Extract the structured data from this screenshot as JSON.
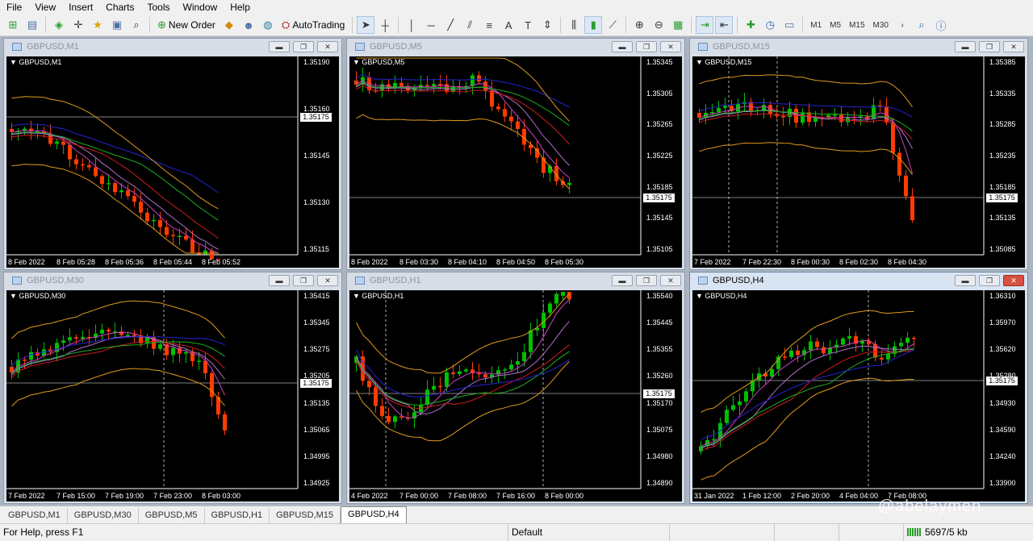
{
  "menu": [
    "File",
    "View",
    "Insert",
    "Charts",
    "Tools",
    "Window",
    "Help"
  ],
  "toolbar": {
    "new_order": "New Order",
    "autotrading": "AutoTrading",
    "timeframes": [
      "M1",
      "M5",
      "M15",
      "M30"
    ]
  },
  "charts": [
    {
      "id": "m1",
      "title": "GBPUSD,M1",
      "price": "1.35175",
      "y_ticks": [
        "1.35190",
        "1.35160",
        "1.35145",
        "1.35130",
        "1.35115"
      ],
      "x_ticks": [
        "8 Feb 2022",
        "8 Feb 05:28",
        "8 Feb 05:36",
        "8 Feb 05:44",
        "8 Feb 05:52"
      ]
    },
    {
      "id": "m5",
      "title": "GBPUSD,M5",
      "price": "1.35175",
      "y_ticks": [
        "1.35345",
        "1.35305",
        "1.35265",
        "1.35225",
        "1.35185",
        "1.35145",
        "1.35105"
      ],
      "x_ticks": [
        "8 Feb 2022",
        "8 Feb 03:30",
        "8 Feb 04:10",
        "8 Feb 04:50",
        "8 Feb 05:30"
      ]
    },
    {
      "id": "m15",
      "title": "GBPUSD,M15",
      "price": "1.35175",
      "y_ticks": [
        "1.35385",
        "1.35335",
        "1.35285",
        "1.35235",
        "1.35185",
        "1.35135",
        "1.35085"
      ],
      "x_ticks": [
        "7 Feb 2022",
        "7 Feb 22:30",
        "8 Feb 00:30",
        "8 Feb 02:30",
        "8 Feb 04:30"
      ]
    },
    {
      "id": "m30",
      "title": "GBPUSD,M30",
      "price": "1.35175",
      "y_ticks": [
        "1.35415",
        "1.35345",
        "1.35275",
        "1.35205",
        "1.35135",
        "1.35065",
        "1.34995",
        "1.34925"
      ],
      "x_ticks": [
        "7 Feb 2022",
        "7 Feb 15:00",
        "7 Feb 19:00",
        "7 Feb 23:00",
        "8 Feb 03:00"
      ]
    },
    {
      "id": "h1",
      "title": "GBPUSD,H1",
      "price": "1.35175",
      "y_ticks": [
        "1.35540",
        "1.35445",
        "1.35355",
        "1.35260",
        "1.35170",
        "1.35075",
        "1.34980",
        "1.34890"
      ],
      "x_ticks": [
        "4 Feb 2022",
        "7 Feb 00:00",
        "7 Feb 08:00",
        "7 Feb 16:00",
        "8 Feb 00:00"
      ]
    },
    {
      "id": "h4",
      "title": "GBPUSD,H4",
      "price": "1.35175",
      "y_ticks": [
        "1.36310",
        "1.35970",
        "1.35620",
        "1.35280",
        "1.34930",
        "1.34590",
        "1.34240",
        "1.33900"
      ],
      "x_ticks": [
        "31 Jan 2022",
        "1 Feb 12:00",
        "2 Feb 20:00",
        "4 Feb 04:00",
        "7 Feb 08:00"
      ]
    }
  ],
  "tabs": [
    "GBPUSD,M1",
    "GBPUSD,M30",
    "GBPUSD,M5",
    "GBPUSD,H1",
    "GBPUSD,M15",
    "GBPUSD,H4"
  ],
  "active_tab": "GBPUSD,H4",
  "watermark": "@abelaymen",
  "status": {
    "help": "For Help, press F1",
    "profile": "Default",
    "traffic": "5697/5 kb"
  },
  "colors": {
    "bull": "#00c000",
    "bear": "#ff3c00",
    "band": "#e09a1e",
    "ma_blue": "#2424d0",
    "ma_red": "#d01c1c",
    "ma_green": "#1cae1c",
    "ma_pink": "#d040c8"
  }
}
